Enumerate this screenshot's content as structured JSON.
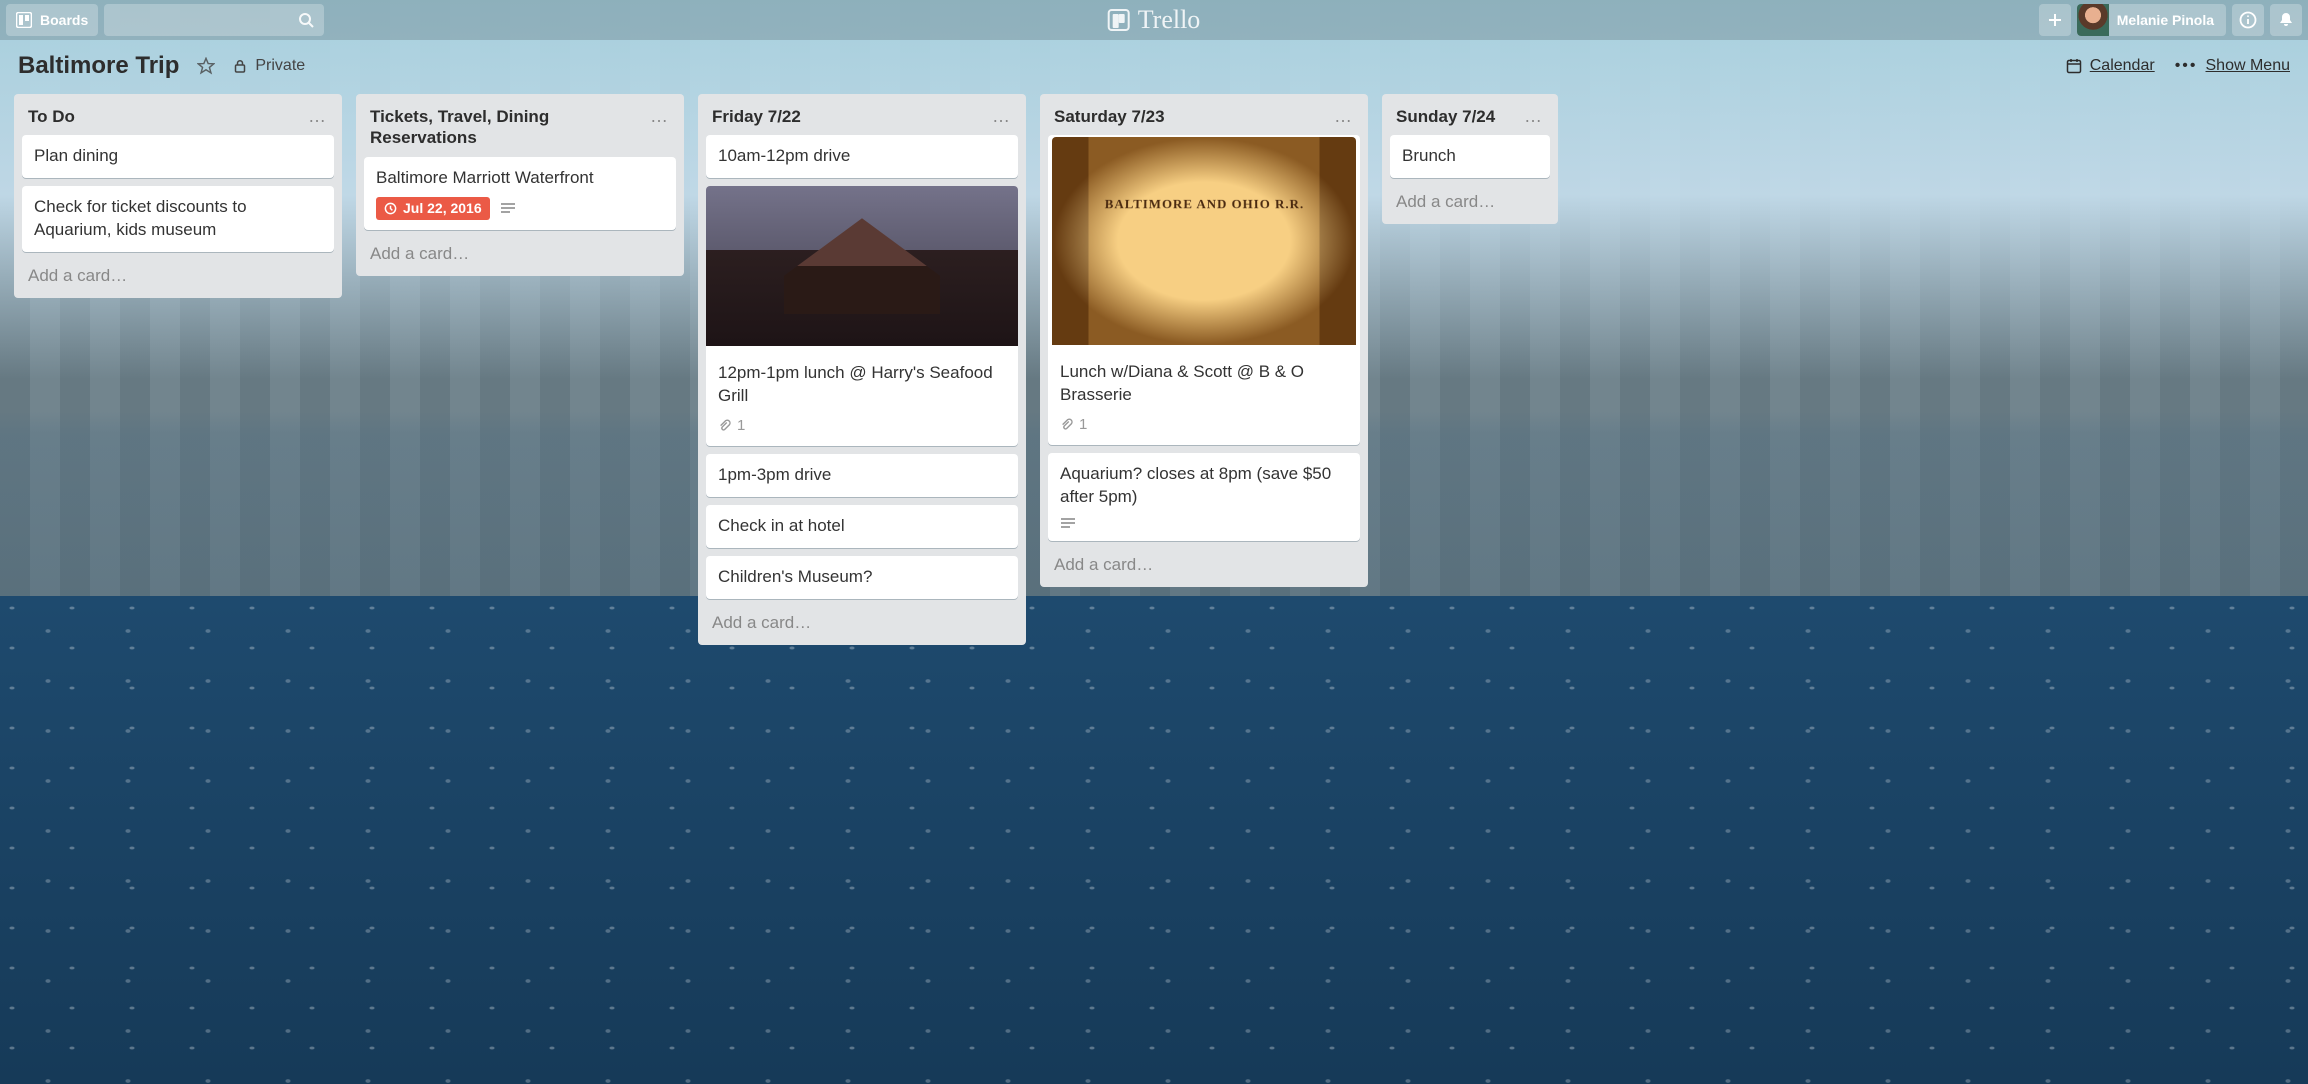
{
  "topbar": {
    "boards_label": "Boards",
    "logo_text": "Trello",
    "user_name": "Melanie Pinola"
  },
  "board_header": {
    "title": "Baltimore Trip",
    "visibility": "Private",
    "calendar_label": "Calendar",
    "menu_label": "Show Menu"
  },
  "lists": [
    {
      "title": "To Do",
      "add_label": "Add a card…",
      "cards": [
        {
          "text": "Plan dining"
        },
        {
          "text": "Check for ticket discounts to Aquarium, kids museum"
        }
      ]
    },
    {
      "title": "Tickets, Travel, Dining Reservations",
      "add_label": "Add a card…",
      "cards": [
        {
          "text": "Baltimore Marriott Waterfront",
          "due": "Jul 22, 2016",
          "has_description": true
        }
      ]
    },
    {
      "title": "Friday 7/22",
      "add_label": "Add a card…",
      "cards": [
        {
          "text": "10am-12pm drive"
        },
        {
          "text": "12pm-1pm lunch @ Harry's Seafood Grill",
          "cover": "harry",
          "attachments": "1"
        },
        {
          "text": "1pm-3pm drive"
        },
        {
          "text": "Check in at hotel"
        },
        {
          "text": "Children's Museum?"
        }
      ]
    },
    {
      "title": "Saturday 7/23",
      "add_label": "Add a card…",
      "cover": "brasserie",
      "cards": [
        {
          "text": "Lunch w/Diana & Scott @ B & O Brasserie",
          "cover": "brasserie",
          "attachments": "1"
        },
        {
          "text": "Aquarium? closes at 8pm (save $50 after 5pm)",
          "has_description": true
        }
      ]
    },
    {
      "title": "Sunday 7/24",
      "add_label": "Add a card…",
      "narrow": true,
      "cards": [
        {
          "text": "Brunch"
        }
      ]
    }
  ]
}
